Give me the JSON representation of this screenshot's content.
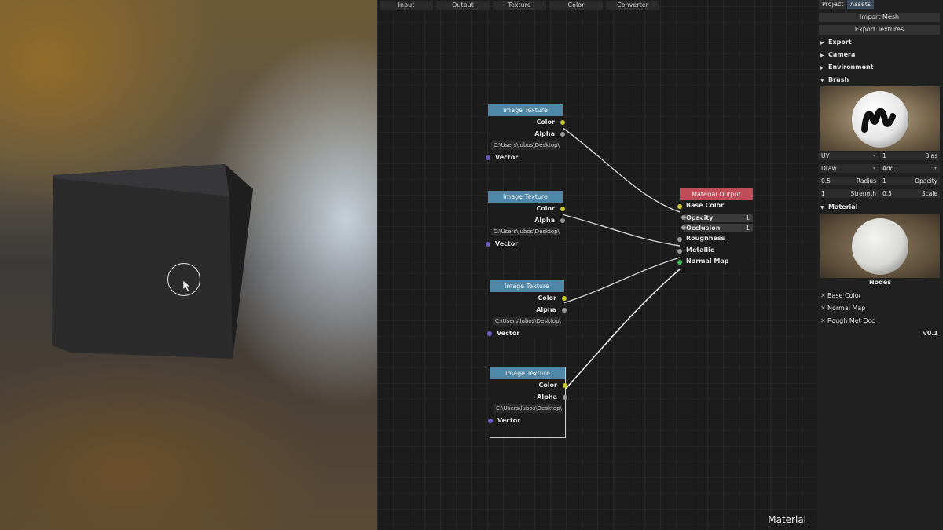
{
  "menu": [
    "Input",
    "Output",
    "Texture",
    "Color",
    "Converter"
  ],
  "image_texture_nodes": [
    {
      "title": "Image Texture",
      "outputs": [
        "Color",
        "Alpha"
      ],
      "path": "C:\\Users\\lubos\\Desktop\\...",
      "input": "Vector"
    },
    {
      "title": "Image Texture",
      "outputs": [
        "Color",
        "Alpha"
      ],
      "path": "C:\\Users\\lubos\\Desktop\\...",
      "input": "Vector"
    },
    {
      "title": "Image Texture",
      "outputs": [
        "Color",
        "Alpha"
      ],
      "path": "C:\\Users\\lubos\\Desktop\\...",
      "input": "Vector"
    },
    {
      "title": "Image Texture",
      "outputs": [
        "Color",
        "Alpha"
      ],
      "path": "C:\\Users\\lubos\\Desktop\\...",
      "input": "Vector"
    }
  ],
  "material_output": {
    "title": "Material Output",
    "base_color": "Base Color",
    "opacity_label": "Opacity",
    "opacity_value": "1",
    "occlusion_label": "Occlusion",
    "occlusion_value": "1",
    "roughness": "Roughness",
    "metallic": "Metallic",
    "normal_map": "Normal Map"
  },
  "editor_label": "Material",
  "panel": {
    "tabs": [
      "Project",
      "Assets"
    ],
    "import_mesh": "Import Mesh",
    "export_textures": "Export Textures",
    "sections": {
      "export": "Export",
      "camera": "Camera",
      "environment": "Environment",
      "brush": "Brush",
      "material": "Material"
    },
    "brush": {
      "uv": "UV",
      "bias_value": "1",
      "bias_label": "Bias",
      "draw": "Draw",
      "add": "Add",
      "radius_value": "0.5",
      "radius_label": "Radius",
      "opacity_value": "1",
      "opacity_label": "Opacity",
      "strength_value": "1",
      "strength_label": "Strength",
      "scale_value": "0.5",
      "scale_label": "Scale"
    },
    "nodes_label": "Nodes",
    "layers": [
      "Base Color",
      "Normal Map",
      "Rough Met Occ"
    ],
    "version": "v0.1"
  },
  "colors": {
    "image_texture_header": "#4f87a8",
    "material_output_header": "#bf4d57",
    "socket_color": "#c9c72a",
    "socket_vector": "#6a5fc6",
    "socket_normal": "#3fb857"
  }
}
